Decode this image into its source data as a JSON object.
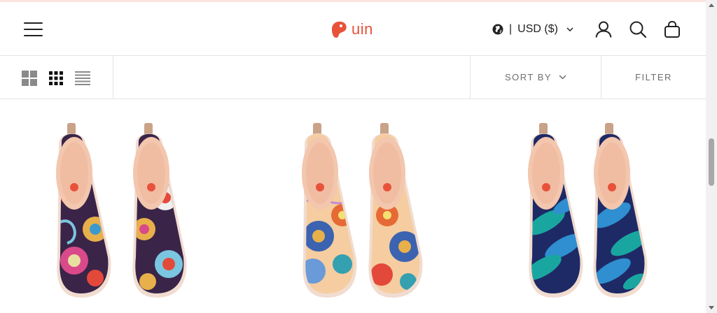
{
  "brand": {
    "name": "uin",
    "icon": "uin-logo-icon",
    "color": "#e8523a"
  },
  "header": {
    "menu_icon": "hamburger-menu-icon",
    "currency": {
      "icon": "globe-icon",
      "label": "USD ($)",
      "dropdown_icon": "chevron-down-icon"
    },
    "account_icon": "user-icon",
    "search_icon": "search-icon",
    "cart_icon": "shopping-bag-icon"
  },
  "toolbar": {
    "view_options": [
      {
        "name": "grid-2-view",
        "icon": "grid-2x2-icon",
        "active": false
      },
      {
        "name": "grid-3-view",
        "icon": "grid-3x3-icon",
        "active": true
      },
      {
        "name": "list-view",
        "icon": "list-icon",
        "active": false
      }
    ],
    "sort_label": "SORT BY",
    "filter_label": "FILTER"
  },
  "products": [
    {
      "image": "pair of slip-on shoes with purple and red paisley print",
      "colors": [
        "#3a2448",
        "#e3493a",
        "#e8b04a"
      ]
    },
    {
      "image": "pair of slip-on shoes with blue and orange floral print on peach",
      "colors": [
        "#f5cda0",
        "#3b63b0",
        "#e66a35"
      ]
    },
    {
      "image": "pair of slip-on shoes with teal leaf print on navy",
      "colors": [
        "#1e2a66",
        "#1aa6a0",
        "#2f8fd0"
      ]
    }
  ]
}
